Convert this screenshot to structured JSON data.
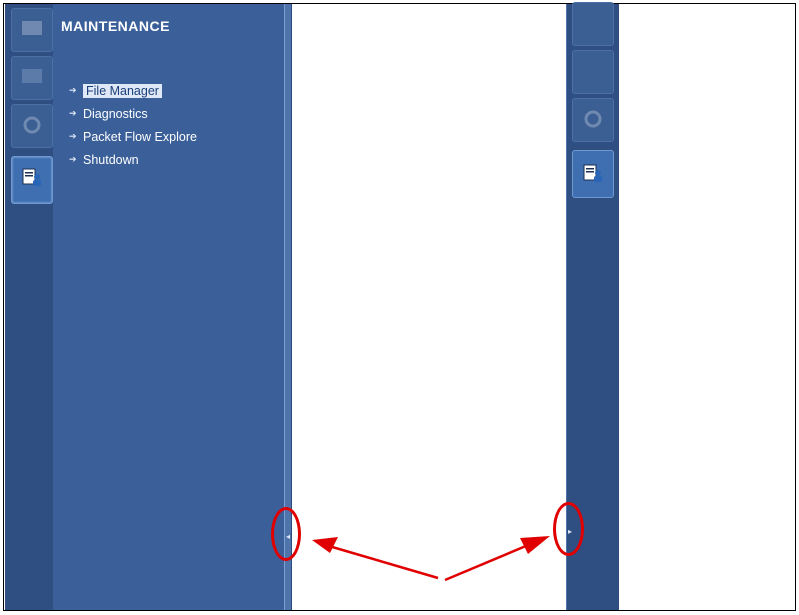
{
  "menu": {
    "title": "MAINTENANCE",
    "items": [
      {
        "label": "File Manager",
        "selected": true
      },
      {
        "label": "Diagnostics",
        "selected": false
      },
      {
        "label": "Packet Flow Explore",
        "selected": false
      },
      {
        "label": "Shutdown",
        "selected": false
      }
    ]
  },
  "tabs": [
    {
      "icon": "monitor-icon",
      "active": false
    },
    {
      "icon": "screen-icon",
      "active": false
    },
    {
      "icon": "gear-icon",
      "active": false
    },
    {
      "icon": "maintenance-user-icon",
      "active": true
    }
  ],
  "colors": {
    "strip": "#2f4f83",
    "panel": "#3a5f99",
    "annotation": "#e10000"
  }
}
